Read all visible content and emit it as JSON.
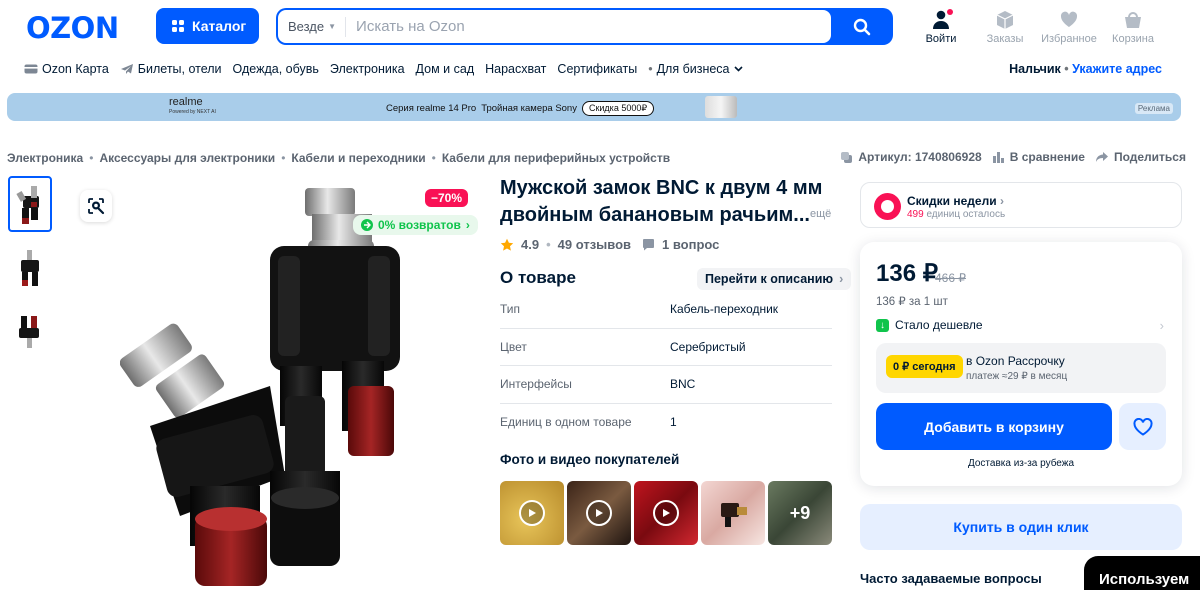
{
  "header": {
    "logo": "OZON",
    "catalog_label": "Каталог",
    "search": {
      "scope": "Везде",
      "placeholder": "Искать на Ozon"
    },
    "icons": [
      {
        "label": "Войти",
        "icon": "user-icon"
      },
      {
        "label": "Заказы",
        "icon": "box-icon"
      },
      {
        "label": "Избранное",
        "icon": "heart-icon"
      },
      {
        "label": "Корзина",
        "icon": "cart-icon"
      }
    ]
  },
  "nav": {
    "items": [
      "Ozon Карта",
      "Билеты, отели",
      "Одежда, обувь",
      "Электроника",
      "Дом и сад",
      "Нарасхват",
      "Сертификаты",
      "Для бизнеса"
    ],
    "city": "Нальчик",
    "address_link": "Укажите адрес"
  },
  "banner": {
    "brand": "realme",
    "brand_sub": "Powered by NEXT AI",
    "series": "Серия realme 14 Pro",
    "feature": "Тройная камера Sony",
    "promo": "Скидка 5000₽",
    "ad_label": "Реклама",
    "bg_color": "#a9cdea"
  },
  "breadcrumbs": [
    "Электроника",
    "Аксессуары для электроники",
    "Кабели и переходники",
    "Кабели для периферийных устройств"
  ],
  "meta": {
    "article": "Артикул: 1740806928",
    "compare": "В сравнение",
    "share": "Поделиться"
  },
  "gallery": {
    "discount": "−70%",
    "returns": "0% возвратов"
  },
  "product": {
    "title": "Мужской замок BNC к двум 4 мм двойным банановым рачьим...",
    "title_more": "ещё",
    "rating": "4.9",
    "reviews": "49 отзывов",
    "questions": "1 вопрос",
    "about_title": "О товаре",
    "goto_description": "Перейти к описанию",
    "specs": [
      {
        "key": "Тип",
        "value": "Кабель-переходник"
      },
      {
        "key": "Цвет",
        "value": "Серебристый"
      },
      {
        "key": "Интерфейсы",
        "value": "BNC"
      },
      {
        "key": "Единиц в одном товаре",
        "value": "1"
      }
    ],
    "ugc_title": "Фото и видео покупателей",
    "ugc_more": "+9"
  },
  "deals": {
    "title": "Скидки недели",
    "count": "499",
    "count_suffix": " единиц осталось"
  },
  "buybox": {
    "price": "136 ₽",
    "old_price": "466 ₽",
    "unit_price": "136 ₽ за 1 шт",
    "cheaper": "Стало дешевле",
    "installment_badge": "0 ₽ сегодня",
    "installment_title": "в Ozon Рассрочку",
    "installment_sub": "платеж ≈29 ₽ в месяц",
    "add_to_cart": "Добавить в корзину",
    "delivery": "Доставка из-за рубежа"
  },
  "one_click": "Купить в один клик",
  "faq_title": "Часто задаваемые вопросы",
  "cookie_text": "Используем",
  "colors": {
    "brand": "#005bff",
    "accent_pink": "#f91155",
    "green": "#10c44c",
    "yellow": "#ffd600"
  }
}
